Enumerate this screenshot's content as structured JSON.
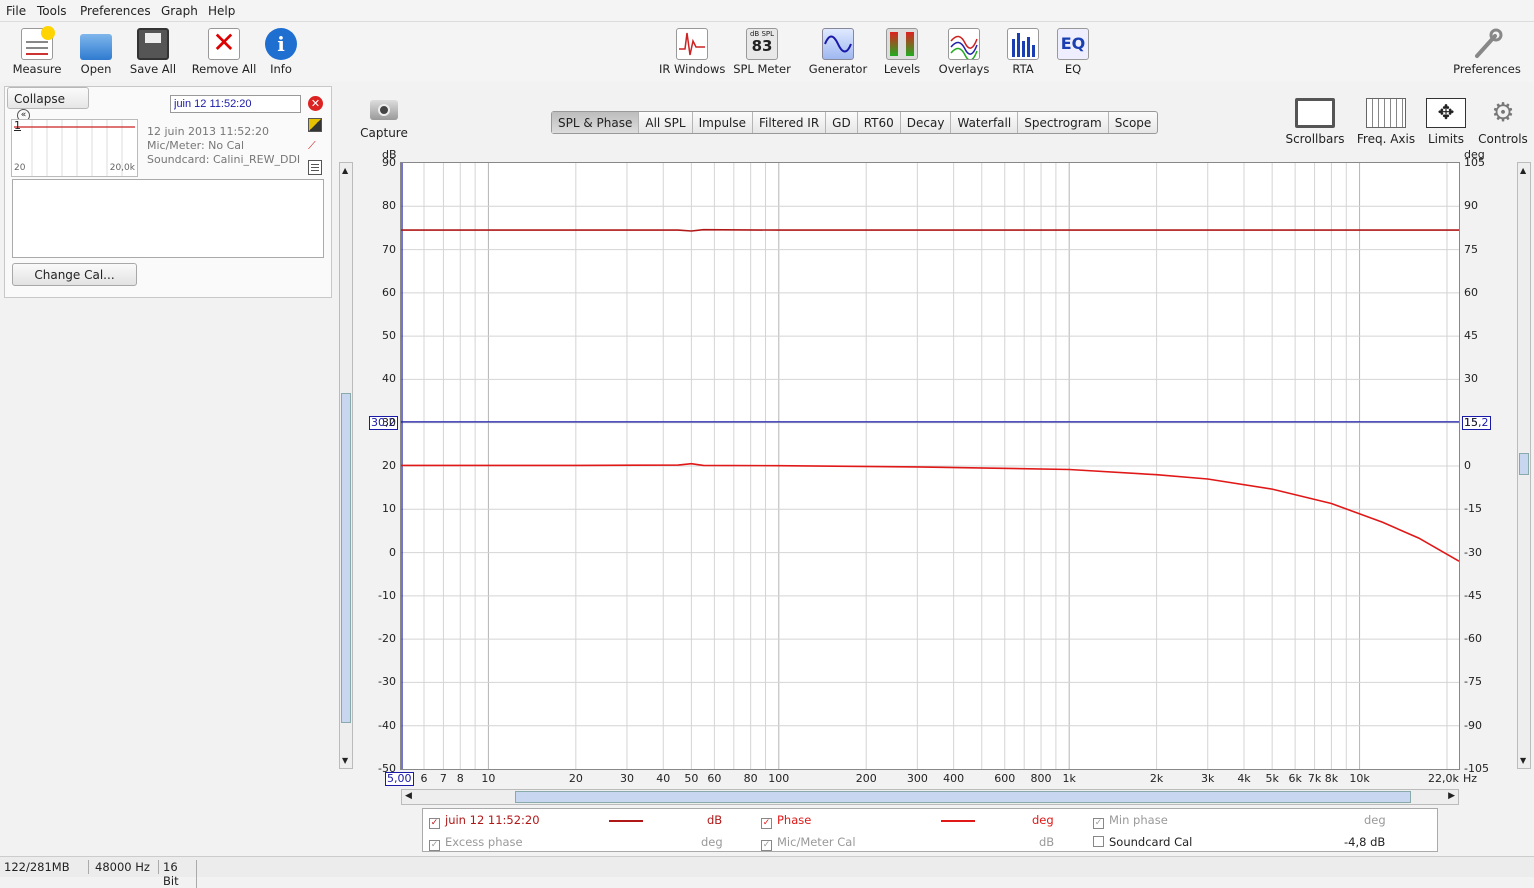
{
  "menu": [
    "File",
    "Tools",
    "Preferences",
    "Graph",
    "Help"
  ],
  "toolbar_left": [
    {
      "label": "Measure",
      "icon": "measure-icon"
    },
    {
      "label": "Open",
      "icon": "folder-open-icon"
    },
    {
      "label": "Save All",
      "icon": "save-all-icon"
    },
    {
      "label": "Remove All",
      "icon": "remove-all-icon"
    },
    {
      "label": "Info",
      "icon": "info-icon"
    }
  ],
  "toolbar_center": [
    {
      "label": "IR Windows",
      "icon": "ir-windows-icon"
    },
    {
      "label": "SPL Meter",
      "icon": "spl-meter-icon",
      "badge_top": "dB SPL",
      "badge_value": "83"
    },
    {
      "label": "Generator",
      "icon": "generator-icon"
    },
    {
      "label": "Levels",
      "icon": "levels-icon"
    },
    {
      "label": "Overlays",
      "icon": "overlays-icon"
    },
    {
      "label": "RTA",
      "icon": "rta-icon"
    },
    {
      "label": "EQ",
      "icon": "eq-icon",
      "badge_value": "EQ"
    }
  ],
  "toolbar_right": {
    "label": "Preferences",
    "icon": "wrench-icon"
  },
  "panel": {
    "collapse_label": "Collapse",
    "measurement_name": "juin 12 11:52:20",
    "thumb_number": "1",
    "thumb_x_start": "20",
    "thumb_x_end": "20,0k",
    "info_date": "12 juin 2013 11:52:20",
    "info_mic": "Mic/Meter: No Cal",
    "info_soundcard": "Soundcard: Calini_REW_DDI",
    "change_cal": "Change Cal..."
  },
  "capture_label": "Capture",
  "graph_tabs": [
    "SPL & Phase",
    "All SPL",
    "Impulse",
    "Filtered IR",
    "GD",
    "RT60",
    "Decay",
    "Waterfall",
    "Spectrogram",
    "Scope"
  ],
  "active_tab": "SPL & Phase",
  "right_tools": [
    {
      "label": "Scrollbars",
      "icon": "scrollbars-icon"
    },
    {
      "label": "Freq. Axis",
      "icon": "freq-axis-icon"
    },
    {
      "label": "Limits",
      "icon": "limits-icon"
    },
    {
      "label": "Controls",
      "icon": "gear-icon"
    }
  ],
  "axes": {
    "left_unit": "dB",
    "right_unit": "deg",
    "x_unit": "Hz",
    "left_ticks": [
      "90",
      "80",
      "70",
      "60",
      "50",
      "40",
      "30",
      "20",
      "10",
      "0",
      "-10",
      "-20",
      "-30",
      "-40",
      "-50"
    ],
    "right_ticks": [
      "105",
      "90",
      "75",
      "60",
      "45",
      "30",
      "15",
      "0",
      "-15",
      "-30",
      "-45",
      "-60",
      "-75",
      "-90",
      "-105"
    ],
    "left_cursor": "30,2",
    "right_cursor": "15,2",
    "x_start": "5,00",
    "x_end": "22,0k",
    "x_ticks": [
      {
        "f": 6,
        "label": "6"
      },
      {
        "f": 7,
        "label": "7"
      },
      {
        "f": 8,
        "label": "8"
      },
      {
        "f": 10,
        "label": "10"
      },
      {
        "f": 20,
        "label": "20"
      },
      {
        "f": 30,
        "label": "30"
      },
      {
        "f": 40,
        "label": "40"
      },
      {
        "f": 50,
        "label": "50"
      },
      {
        "f": 60,
        "label": "60"
      },
      {
        "f": 80,
        "label": "80"
      },
      {
        "f": 100,
        "label": "100"
      },
      {
        "f": 200,
        "label": "200"
      },
      {
        "f": 300,
        "label": "300"
      },
      {
        "f": 400,
        "label": "400"
      },
      {
        "f": 600,
        "label": "600"
      },
      {
        "f": 800,
        "label": "800"
      },
      {
        "f": 1000,
        "label": "1k"
      },
      {
        "f": 2000,
        "label": "2k"
      },
      {
        "f": 3000,
        "label": "3k"
      },
      {
        "f": 4000,
        "label": "4k"
      },
      {
        "f": 5000,
        "label": "5k"
      },
      {
        "f": 6000,
        "label": "6k"
      },
      {
        "f": 7000,
        "label": "7k"
      },
      {
        "f": 8000,
        "label": "8k"
      },
      {
        "f": 10000,
        "label": "10k"
      }
    ]
  },
  "chart_data": {
    "type": "line",
    "x_scale": "log",
    "xlim": [
      5,
      22000
    ],
    "ylim_left": [
      -50,
      90
    ],
    "ylim_right": [
      -105,
      105
    ],
    "cursor_level_db": 30.2,
    "series": [
      {
        "name": "juin 12 11:52:20",
        "unit": "dB",
        "color": "#b01818",
        "x": [
          5,
          20,
          45,
          50,
          55,
          100,
          1000,
          10000,
          22000
        ],
        "y": [
          74.5,
          74.5,
          74.5,
          74.3,
          74.6,
          74.5,
          74.5,
          74.5,
          74.5
        ]
      },
      {
        "name": "Phase",
        "unit": "deg",
        "color": "#e01818",
        "x": [
          5,
          20,
          45,
          50,
          55,
          100,
          300,
          1000,
          2000,
          3000,
          5000,
          8000,
          12000,
          16000,
          22000
        ],
        "y": [
          0.2,
          0.2,
          0.3,
          0.8,
          0.2,
          0.1,
          -0.3,
          -1.2,
          -3,
          -4.5,
          -8,
          -13,
          -19.5,
          -25,
          -33
        ]
      }
    ]
  },
  "legend": {
    "row1": [
      {
        "label": "juin 12 11:52:20",
        "checked": true,
        "unit": "dB",
        "color": "#b01818"
      },
      {
        "label": "Phase",
        "checked": true,
        "unit": "deg",
        "color": "#e01818"
      },
      {
        "label": "Min phase",
        "checked": true,
        "unit": "deg"
      }
    ],
    "row2": [
      {
        "label": "Excess phase",
        "checked": true,
        "unit": "deg"
      },
      {
        "label": "Mic/Meter Cal",
        "checked": true,
        "unit": "dB"
      },
      {
        "label": "Soundcard Cal",
        "checked": false,
        "value": "-4,8 dB"
      }
    ]
  },
  "status": {
    "memory": "122/281MB",
    "rate": "48000 Hz",
    "bits": "16 Bit"
  }
}
